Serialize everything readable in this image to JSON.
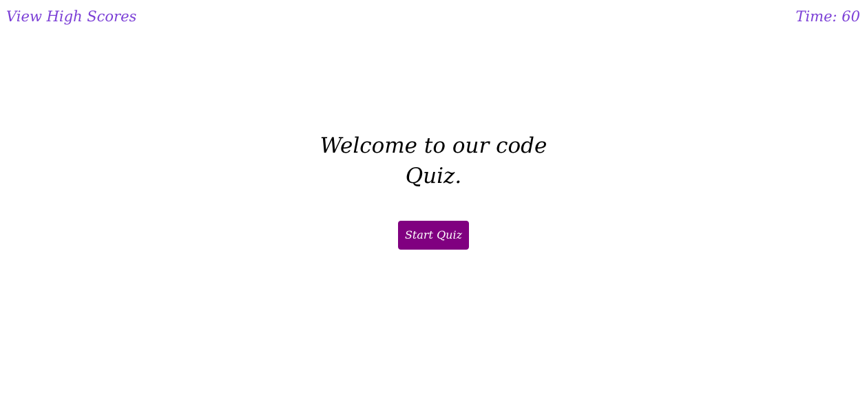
{
  "header": {
    "high_scores_label": "View High Scores",
    "timer_text": "Time: 60"
  },
  "main": {
    "title": "Welcome to our code Quiz.",
    "start_button_label": "Start Quiz"
  },
  "colors": {
    "accent_text": "#7b3fd6",
    "button_background": "#800080",
    "button_text": "#ffffff",
    "title_text": "#000000",
    "page_background": "#ffffff"
  }
}
